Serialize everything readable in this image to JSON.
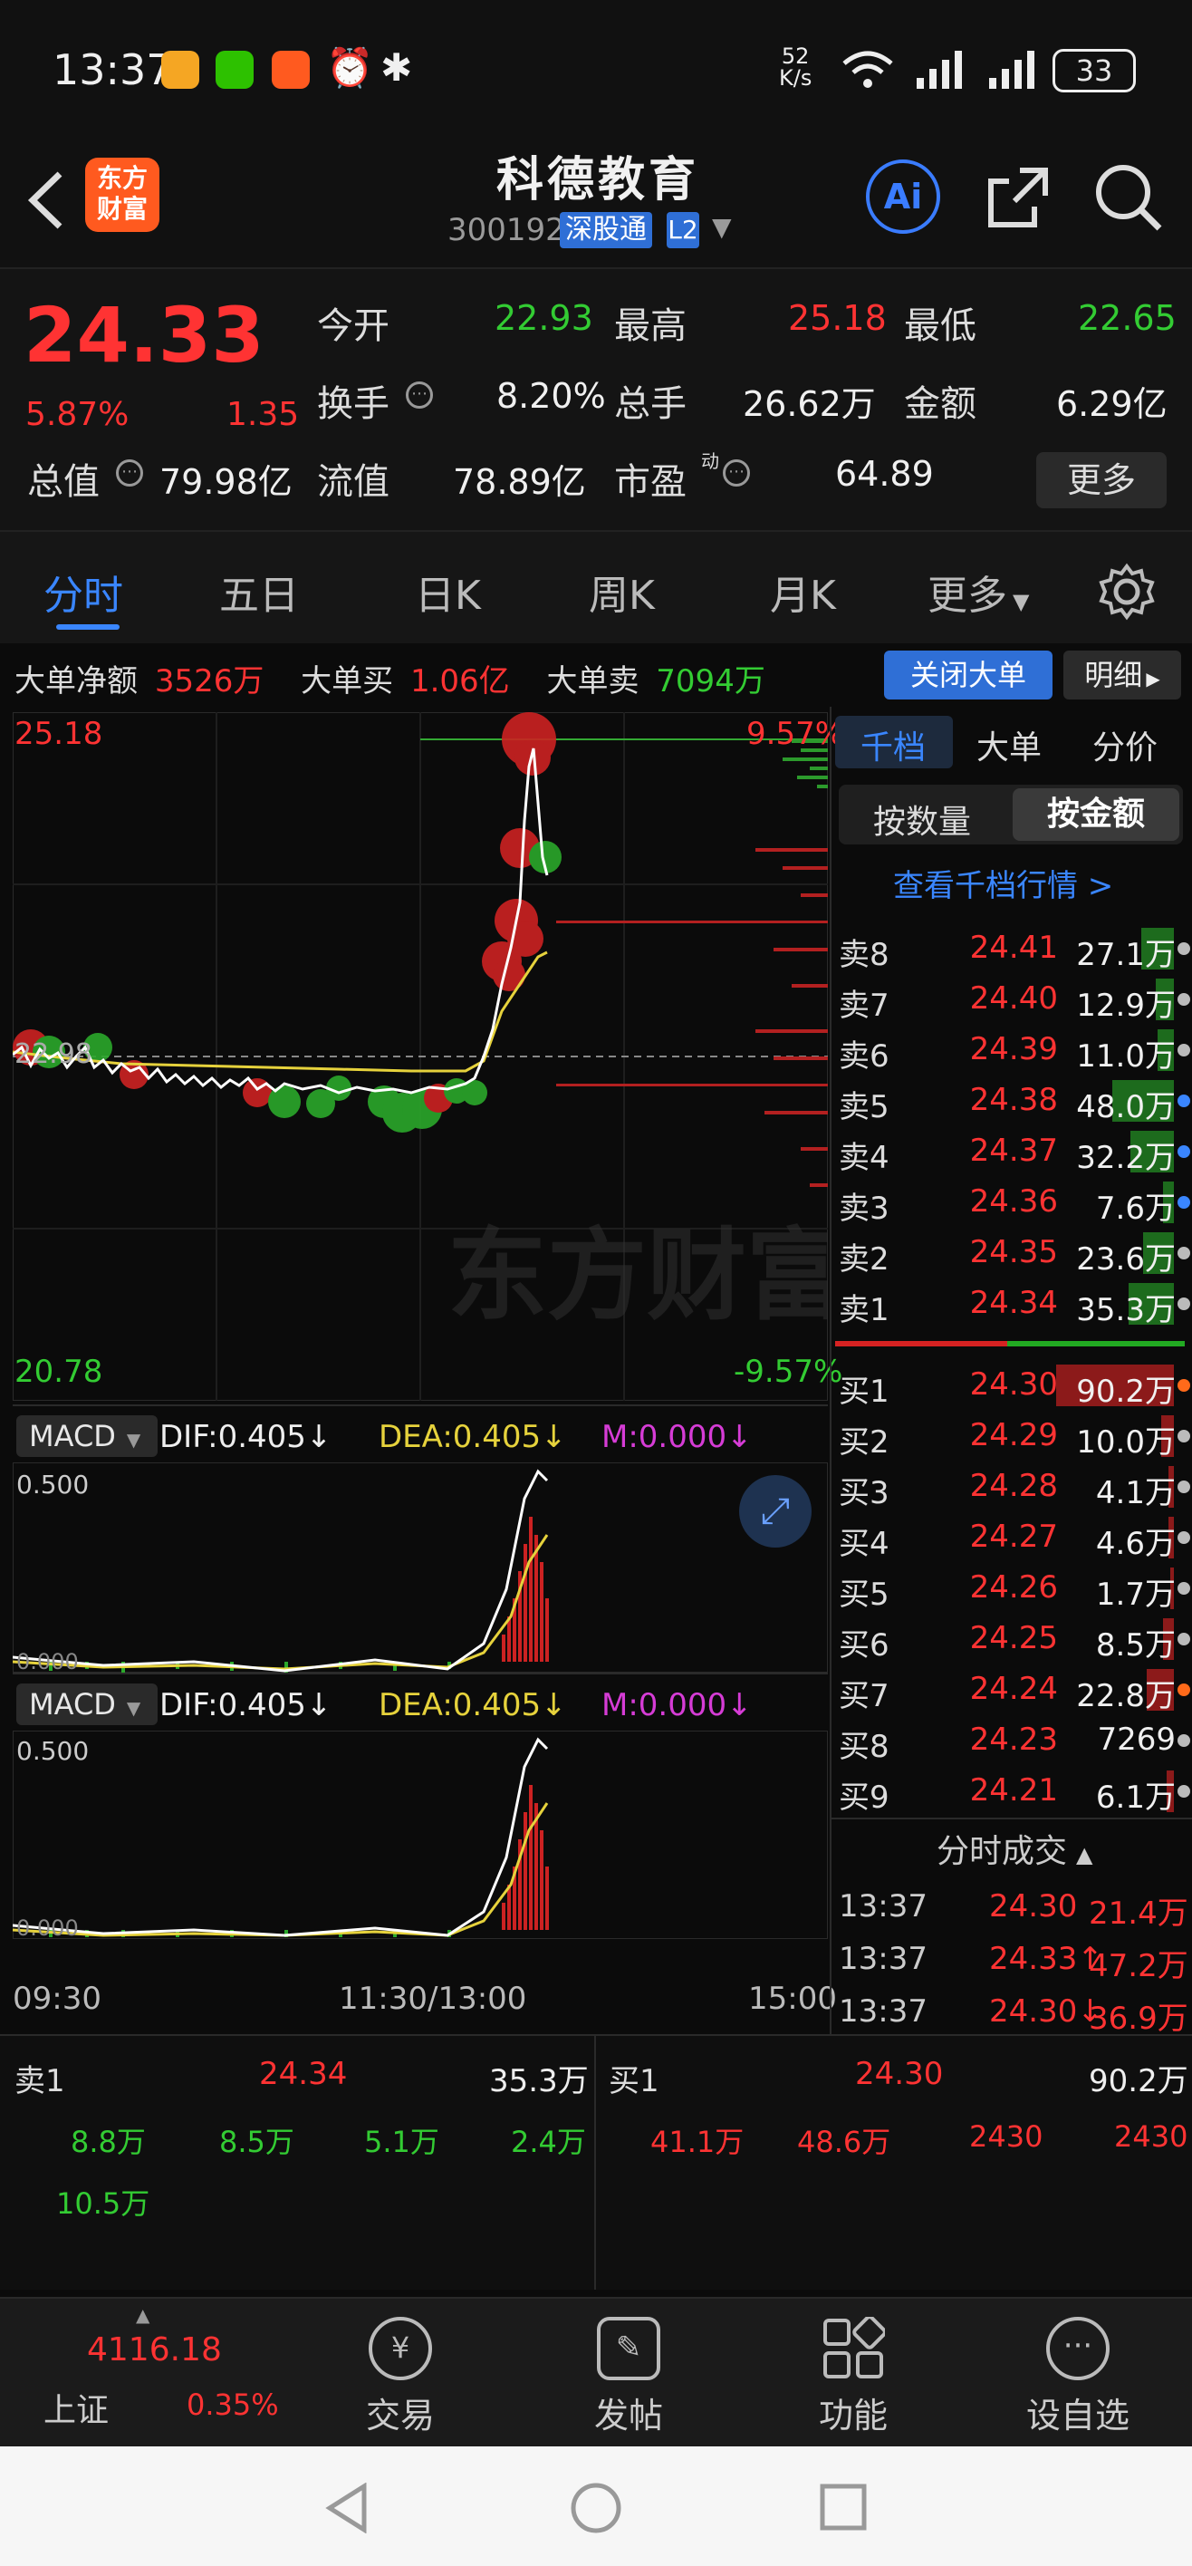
{
  "status_bar": {
    "time": "13:37",
    "net_speed_value": "52",
    "net_speed_unit": "K/s",
    "battery": "33"
  },
  "header": {
    "app_logo": "东方\n财富",
    "stock_name": "科德教育",
    "stock_code": "300192",
    "connect_badge": "深股通",
    "level_badge": "L2",
    "ai_label": "Ai"
  },
  "quote": {
    "price": "24.33",
    "change_pct": "5.87%",
    "change_amt": "1.35",
    "open_label": "今开",
    "open_value": "22.93",
    "high_label": "最高",
    "high_value": "25.18",
    "low_label": "最低",
    "low_value": "22.65",
    "turnover_label": "换手",
    "turnover_value": "8.20%",
    "volume_label": "总手",
    "volume_value": "26.62万",
    "amount_label": "金额",
    "amount_value": "6.29亿",
    "mcap_label": "总值",
    "mcap_value": "79.98亿",
    "float_label": "流值",
    "float_value": "78.89亿",
    "pe_label": "市盈",
    "pe_sup": "动",
    "pe_value": "64.89",
    "more_button": "更多"
  },
  "tabs": [
    "分时",
    "五日",
    "日K",
    "周K",
    "月K",
    "更多"
  ],
  "bigorder": {
    "net_label": "大单净额",
    "net_value": "3526万",
    "buy_label": "大单买",
    "buy_value": "1.06亿",
    "sell_label": "大单卖",
    "sell_value": "7094万",
    "close_button": "关闭大单",
    "detail_button": "明细"
  },
  "price_chart": {
    "max_price": "25.18",
    "max_pct": "9.57%",
    "prev_close": "22.98",
    "min_price": "20.78",
    "min_pct": "-9.57%",
    "watermark": "东方财富"
  },
  "macd1": {
    "name": "MACD",
    "dif": "DIF:0.405↓",
    "dea": "DEA:0.405↓",
    "m": "M:0.000↓",
    "top": "0.500",
    "bottom": "0.000"
  },
  "macd2": {
    "name": "MACD",
    "dif": "DIF:0.405↓",
    "dea": "DEA:0.405↓",
    "m": "M:0.000↓",
    "top": "0.500",
    "bottom": "0.000"
  },
  "time_axis": {
    "start": "09:30",
    "mid": "11:30/13:00",
    "end": "15:00"
  },
  "side_panel": {
    "tabs": [
      "千档",
      "大单",
      "分价"
    ],
    "sort_by_qty": "按数量",
    "sort_by_amt": "按金额",
    "view_link": "查看千档行情 >",
    "asks": [
      {
        "label": "卖8",
        "price": "24.41",
        "qty": "27.1万"
      },
      {
        "label": "卖7",
        "price": "24.40",
        "qty": "12.9万"
      },
      {
        "label": "卖6",
        "price": "24.39",
        "qty": "11.0万"
      },
      {
        "label": "卖5",
        "price": "24.38",
        "qty": "48.0万"
      },
      {
        "label": "卖4",
        "price": "24.37",
        "qty": "32.2万"
      },
      {
        "label": "卖3",
        "price": "24.36",
        "qty": "7.6万"
      },
      {
        "label": "卖2",
        "price": "24.35",
        "qty": "23.6万"
      },
      {
        "label": "卖1",
        "price": "24.34",
        "qty": "35.3万"
      }
    ],
    "bids": [
      {
        "label": "买1",
        "price": "24.30",
        "qty": "90.2万"
      },
      {
        "label": "买2",
        "price": "24.29",
        "qty": "10.0万"
      },
      {
        "label": "买3",
        "price": "24.28",
        "qty": "4.1万"
      },
      {
        "label": "买4",
        "price": "24.27",
        "qty": "4.6万"
      },
      {
        "label": "买5",
        "price": "24.26",
        "qty": "1.7万"
      },
      {
        "label": "买6",
        "price": "24.25",
        "qty": "8.5万"
      },
      {
        "label": "买7",
        "price": "24.24",
        "qty": "22.8万"
      },
      {
        "label": "买8",
        "price": "24.23",
        "qty": "7269"
      },
      {
        "label": "买9",
        "price": "24.21",
        "qty": "6.1万"
      }
    ],
    "trades_title": "分时成交",
    "trades": [
      {
        "time": "13:37",
        "price": "24.30",
        "qty": "21.4万"
      },
      {
        "time": "13:37",
        "price": "24.33↑",
        "qty": "47.2万"
      },
      {
        "time": "13:37",
        "price": "24.30↓",
        "qty": "36.9万"
      }
    ]
  },
  "depth": {
    "sell_label": "卖1",
    "sell_price": "24.34",
    "sell_qty": "35.3万",
    "buy_label": "买1",
    "buy_price": "24.30",
    "buy_qty": "90.2万",
    "sell_queue": [
      "8.8万",
      "8.5万",
      "5.1万",
      "2.4万",
      "10.5万"
    ],
    "buy_queue": [
      "41.1万",
      "48.6万",
      "2430",
      "2430"
    ]
  },
  "bottom_nav": {
    "index_value": "4116.18",
    "index_name": "上证",
    "index_pct": "0.35%",
    "items": [
      "交易",
      "发帖",
      "功能",
      "设自选"
    ]
  }
}
